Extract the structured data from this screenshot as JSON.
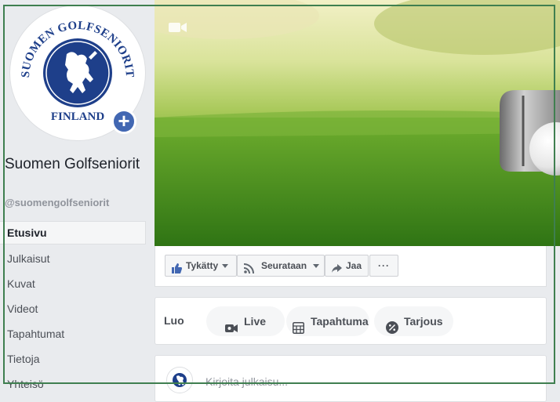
{
  "page": {
    "name": "Suomen Golfseniorit",
    "handle": "@suomengolfseniorit",
    "logo_text_top": "SUOMEN GOLFSENIORIT",
    "logo_text_bottom": "FINLAND"
  },
  "sidebar": {
    "items": [
      {
        "label": "Etusivu",
        "active": true
      },
      {
        "label": "Julkaisut"
      },
      {
        "label": "Kuvat"
      },
      {
        "label": "Videot"
      },
      {
        "label": "Tapahtumat"
      },
      {
        "label": "Tietoja"
      },
      {
        "label": "Yhteisö"
      }
    ]
  },
  "actions": {
    "like_label": "Tykätty",
    "follow_label": "Seurataan",
    "share_label": "Jaa",
    "more_label": "···"
  },
  "create": {
    "title": "Luo",
    "live_label": "Live",
    "event_label": "Tapahtuma",
    "offer_label": "Tarjous"
  },
  "composer": {
    "placeholder": "Kirjoita julkaisu..."
  },
  "colors": {
    "brand": "#4267b2",
    "logo_blue": "#1e3f8a",
    "frame": "#3f7f50"
  },
  "icons": {
    "cover_video": "video-camera-icon",
    "add_photo": "plus-icon",
    "like": "thumbs-up-icon",
    "follow": "rss-icon",
    "share": "share-arrow-icon",
    "live": "video-camera-icon",
    "event": "calendar-icon",
    "offer": "percent-icon"
  }
}
